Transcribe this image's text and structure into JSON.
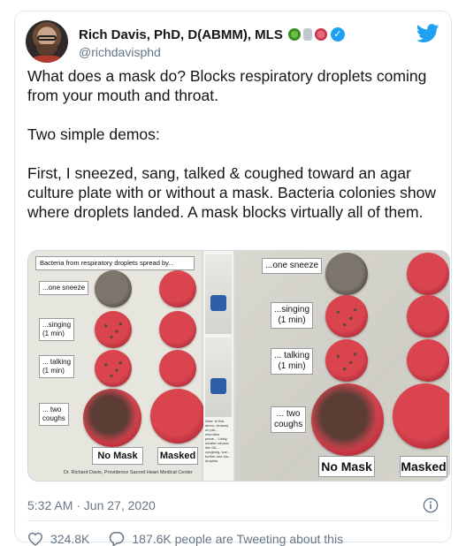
{
  "author": {
    "display_name": "Rich Davis, PhD, D(ABMM), MLS",
    "handle": "@richdavisphd",
    "badges": [
      "virus-emoji",
      "microscope-emoji",
      "petri-dish-emoji",
      "verified-badge"
    ]
  },
  "tweet": {
    "text": "What does a mask do? Blocks respiratory droplets coming from your mouth and throat.\n\nTwo simple demos:\n\nFirst, I sneezed, sang, talked & coughed toward an agar culture plate with or without a mask. Bacteria colonies show where droplets landed. A mask blocks virtually all of them."
  },
  "media": {
    "left_title": "Bacteria from respiratory droplets spread by...",
    "rows": [
      "...one sneeze",
      "...singing\n(1 min)",
      "... talking\n(1 min)",
      "... two\ncoughs"
    ],
    "columns": [
      "No Mask",
      "Masked"
    ],
    "credit": "Dr. Richard Davis, Providence Sacred Heart Medical Center",
    "note": "Note: In this demo, viruses) on pla... microbes prese... Likely, smaller viruses like SA... coughing, sne... further and sta... droplets."
  },
  "footer": {
    "timestamp": "5:32 AM · Jun 27, 2020",
    "likes": "324.8K",
    "tweeting": "187.6K people are Tweeting about this"
  },
  "colors": {
    "accent": "#1da1f2",
    "muted": "#657786",
    "agar": "#d9444f"
  }
}
